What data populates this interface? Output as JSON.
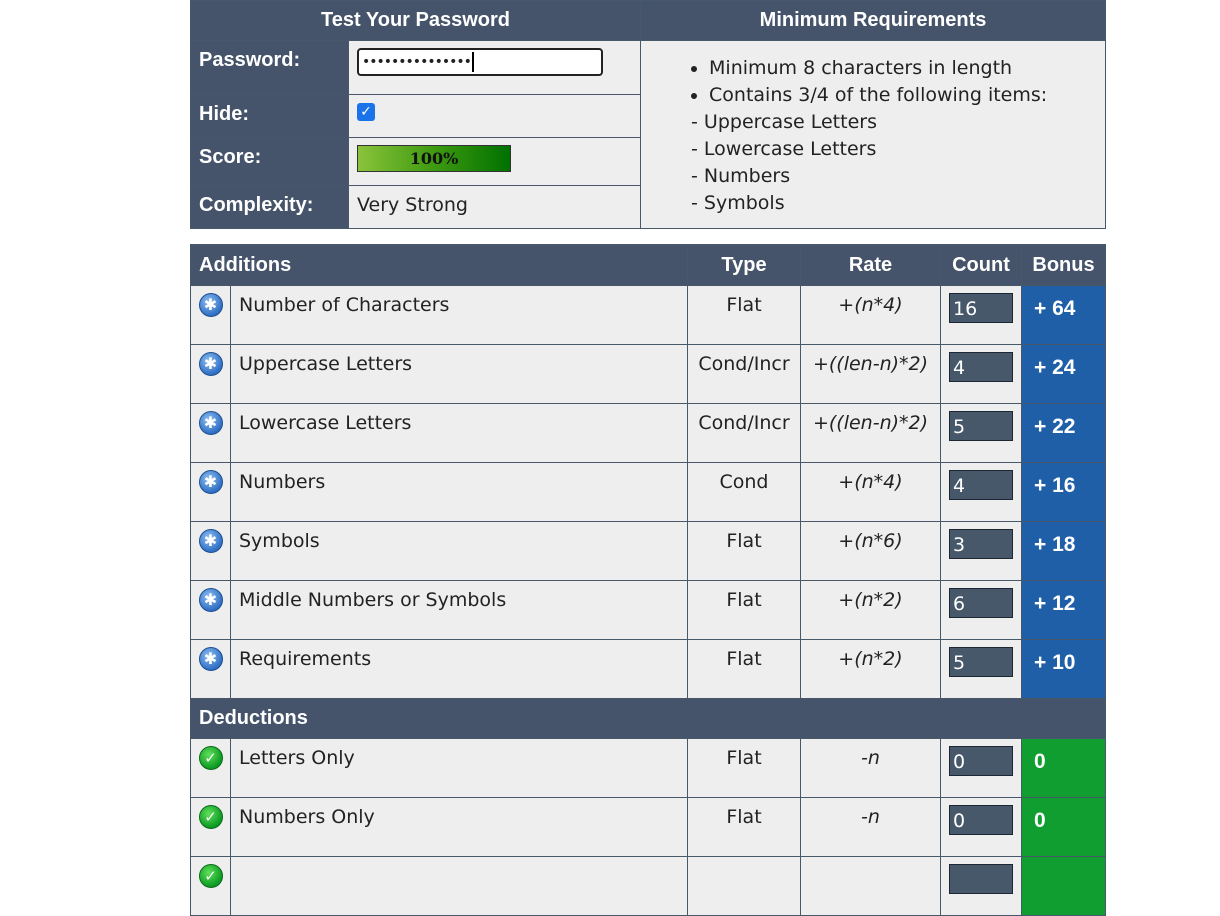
{
  "top": {
    "test_header": "Test Your Password",
    "req_header": "Minimum Requirements",
    "password_label": "Password:",
    "password_value": "•••••••••••••••",
    "hide_label": "Hide:",
    "hide_checked": true,
    "score_label": "Score:",
    "score_value": "100%",
    "complexity_label": "Complexity:",
    "complexity_value": "Very Strong",
    "requirements": [
      "Minimum 8 characters in length",
      "Contains 3/4 of the following items:"
    ],
    "sub_requirements": [
      "- Uppercase Letters",
      "- Lowercase Letters",
      "- Numbers",
      "- Symbols"
    ]
  },
  "main": {
    "headers": {
      "additions": "Additions",
      "type": "Type",
      "rate": "Rate",
      "count": "Count",
      "bonus": "Bonus"
    },
    "deductions_label": "Deductions",
    "additions": [
      {
        "name": "Number of Characters",
        "type": "Flat",
        "rate": "+(n*4)",
        "count": "16",
        "bonus": "+ 64"
      },
      {
        "name": "Uppercase Letters",
        "type": "Cond/Incr",
        "rate": "+((len-n)*2)",
        "count": "4",
        "bonus": "+ 24"
      },
      {
        "name": "Lowercase Letters",
        "type": "Cond/Incr",
        "rate": "+((len-n)*2)",
        "count": "5",
        "bonus": "+ 22"
      },
      {
        "name": "Numbers",
        "type": "Cond",
        "rate": "+(n*4)",
        "count": "4",
        "bonus": "+ 16"
      },
      {
        "name": "Symbols",
        "type": "Flat",
        "rate": "+(n*6)",
        "count": "3",
        "bonus": "+ 18"
      },
      {
        "name": "Middle Numbers or Symbols",
        "type": "Flat",
        "rate": "+(n*2)",
        "count": "6",
        "bonus": "+ 12"
      },
      {
        "name": "Requirements",
        "type": "Flat",
        "rate": "+(n*2)",
        "count": "5",
        "bonus": "+ 10"
      }
    ],
    "deductions": [
      {
        "name": "Letters Only",
        "type": "Flat",
        "rate": "-n",
        "count": "0",
        "bonus": "0"
      },
      {
        "name": "Numbers Only",
        "type": "Flat",
        "rate": "-n",
        "count": "0",
        "bonus": "0"
      }
    ]
  },
  "colors": {
    "header_bg": "#45546a",
    "bonus_blue": "#1e5fa8",
    "bonus_green": "#0f9e2f",
    "row_bg": "#eeeeee"
  },
  "icons": {
    "addition": "star-badge-icon",
    "deduction": "checkmark-icon"
  }
}
